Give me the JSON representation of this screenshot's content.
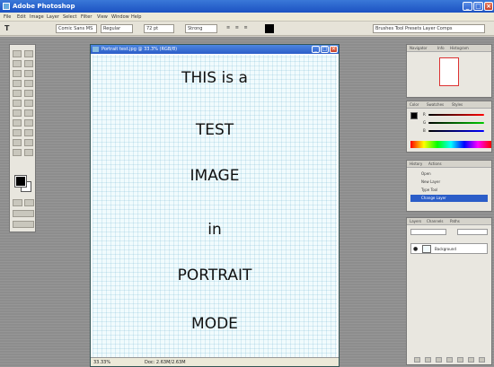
{
  "app": {
    "title": "Adobe Photoshop"
  },
  "window_controls": {
    "minimize": "_",
    "maximize": "□",
    "close": "×"
  },
  "menu": [
    "File",
    "Edit",
    "Image",
    "Layer",
    "Select",
    "Filter",
    "View",
    "Window",
    "Help"
  ],
  "options_bar": {
    "tool_glyph": "T",
    "font_family": "Comic Sans MS",
    "font_style": "Regular",
    "font_size": "72 pt",
    "antialias": "Strong",
    "palettes": "Brushes  Tool Presets  Layer Comps"
  },
  "document": {
    "title": "Portrait test.jpg @ 33.3% (RGB/8)",
    "lines": [
      "THIS is a",
      "TEST",
      "IMAGE",
      "in",
      "PORTRAIT",
      "MODE"
    ],
    "zoom": "33.33%",
    "doc_size": "Doc: 2.63M/2.63M"
  },
  "panels": {
    "navigator": {
      "tabs": [
        "Navigator",
        "Info",
        "Histogram"
      ]
    },
    "color": {
      "tabs": [
        "Color",
        "Swatches",
        "Styles"
      ],
      "channels": [
        "R",
        "G",
        "B"
      ]
    },
    "history": {
      "tabs": [
        "History",
        "Actions"
      ],
      "items": [
        "Open",
        "New Layer",
        "Type Tool",
        "Change Layer"
      ]
    },
    "layers": {
      "tabs": [
        "Layers",
        "Channels",
        "Paths"
      ],
      "layer_name": "Background"
    }
  }
}
